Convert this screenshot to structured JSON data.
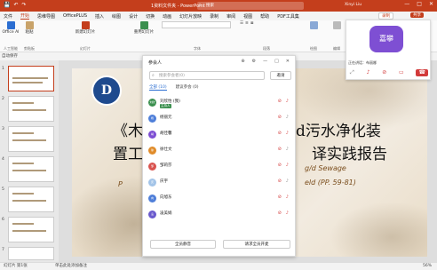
{
  "titlebar": {
    "doc_title": "1资料文件夹 - PowerPoint",
    "search_placeholder": "搜索",
    "user": "Xinyi Liu",
    "minimize": "—",
    "maximize": "□",
    "close": "✕"
  },
  "tabs": [
    "文件",
    "开始",
    "思维导图",
    "OfficePLUS",
    "插入",
    "绘图",
    "设计",
    "切换",
    "动画",
    "幻灯片放映",
    "录制",
    "审阅",
    "视图",
    "帮助",
    "PDF工具集"
  ],
  "active_tab": "开始",
  "record_label": "录制",
  "share_label": "共享",
  "ribbon": {
    "officeai_label": "Office AI",
    "officeai_cap": "人工智能",
    "paste_label": "粘贴",
    "paste_cap": "剪贴板",
    "newslide_label": "新建幻灯片",
    "reuse_label": "重用幻灯片",
    "slides_cap": "幻灯片",
    "font_cap": "字体",
    "para_cap": "段落",
    "draw_cap": "绘图",
    "edit_cap": "编辑",
    "voice_cap": "语音",
    "designer_cap": "设计器"
  },
  "autosave": "自动保存",
  "slides": [
    {
      "num": "1"
    },
    {
      "num": "2"
    },
    {
      "num": "3"
    },
    {
      "num": "4"
    },
    {
      "num": "5"
    },
    {
      "num": "6"
    },
    {
      "num": "7"
    },
    {
      "num": "8"
    }
  ],
  "slide": {
    "logo_text": "D",
    "title_line1_left": "《木",
    "title_line1_right": "d污水净化装",
    "title_line2_left": "置工",
    "title_line2_right": "译实践报告",
    "sub1_left": "P",
    "sub1_right": "g/d Sewage",
    "sub2_right": "eld (PP. 59-81)"
  },
  "status": {
    "page": "幻灯片 第1张",
    "hint": "单击此处添加备注",
    "zoom": "56%"
  },
  "participants": {
    "header": "参会人",
    "search_placeholder": "搜索参会者(0)",
    "invite": "邀请",
    "tab_all": "全部 (10)",
    "tab_absent": "建议参会 (0)",
    "rows": [
      {
        "avatar": "刘欣",
        "name": "刘欣怡 (我)",
        "tag": "主持人",
        "color": "#3a8f4e"
      },
      {
        "avatar": "杨",
        "name": "杨丽元",
        "tag": "",
        "color": "#4f7fd9"
      },
      {
        "avatar": "胡",
        "name": "胡佳馨",
        "tag": "",
        "color": "#7e4fd3"
      },
      {
        "avatar": "徐",
        "name": "徐仕文",
        "tag": "",
        "color": "#e08c2a"
      },
      {
        "avatar": "邹",
        "name": "邹莉莎",
        "tag": "",
        "color": "#d9534f"
      },
      {
        "avatar": "庆",
        "name": "庆宇",
        "tag": "",
        "color": "#a3c4e8"
      },
      {
        "avatar": "向",
        "name": "向旭东",
        "tag": "",
        "color": "#4f7fd9"
      },
      {
        "avatar": "凌",
        "name": "凌美娟",
        "tag": "",
        "color": "#6a5acd"
      }
    ],
    "mute_all": "全员静音",
    "unmute_all": "请求全员开麦"
  },
  "video": {
    "avatar_text": "嘉攀",
    "name_line": "正在讲话：布丽娜"
  }
}
